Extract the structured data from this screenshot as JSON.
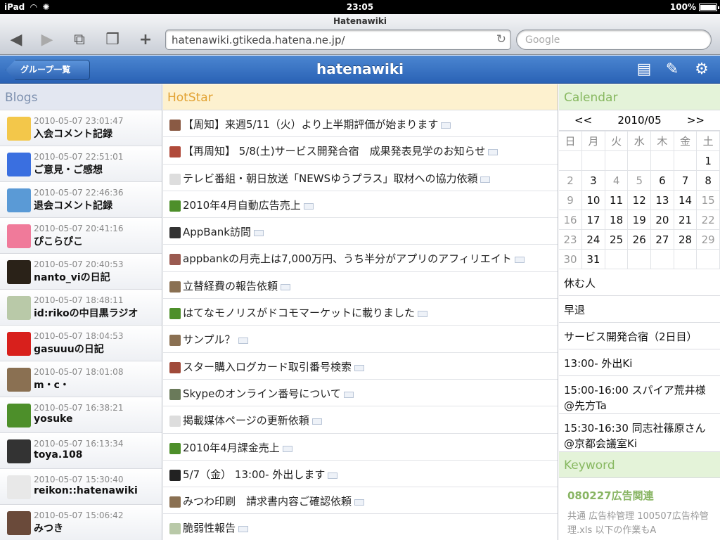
{
  "status": {
    "device": "iPad",
    "time": "23:05",
    "battery": "100%"
  },
  "browser": {
    "title": "Hatenawiki",
    "url": "hatenawiki.gtikeda.hatena.ne.jp/",
    "search_placeholder": "Google"
  },
  "nav": {
    "back_label": "グループ一覧",
    "title": "hatenawiki"
  },
  "blogs": {
    "header": "Blogs",
    "items": [
      {
        "date": "2010-05-07 23:01:47",
        "name": "入会コメント記録",
        "color": "#f3c74a"
      },
      {
        "date": "2010-05-07 22:51:01",
        "name": "ご意見・ご感想",
        "color": "#3a6fe0"
      },
      {
        "date": "2010-05-07 22:46:36",
        "name": "退会コメント記録",
        "color": "#5a9ad6"
      },
      {
        "date": "2010-05-07 20:41:16",
        "name": "ぴこらぴこ",
        "color": "#f07a9a"
      },
      {
        "date": "2010-05-07 20:40:53",
        "name": "nanto_viの日記",
        "color": "#2a2218"
      },
      {
        "date": "2010-05-07 18:48:11",
        "name": "id:rikoの中目黒ラジオ",
        "color": "#b9c9a8"
      },
      {
        "date": "2010-05-07 18:04:53",
        "name": "gasuuuの日記",
        "color": "#d8201c"
      },
      {
        "date": "2010-05-07 18:01:08",
        "name": "m・c・",
        "color": "#8a7052"
      },
      {
        "date": "2010-05-07 16:38:21",
        "name": "yosuke",
        "color": "#4d8f2a"
      },
      {
        "date": "2010-05-07 16:13:34",
        "name": "toya.108",
        "color": "#333333"
      },
      {
        "date": "2010-05-07 15:30:40",
        "name": "reikon::hatenawiki",
        "color": "#e8e8e8"
      },
      {
        "date": "2010-05-07 15:06:42",
        "name": "みつき",
        "color": "#6a4a3a"
      }
    ]
  },
  "hotstar": {
    "header": "HotStar",
    "items": [
      {
        "text": "【周知】来週5/11（火）より上半期評価が始まります",
        "color": "#8a5a44"
      },
      {
        "text": "【再周知】 5/8(土)サービス開発合宿　成果発表見学のお知らせ",
        "color": "#b04a3a"
      },
      {
        "text": "テレビ番組・朝日放送「NEWSゆうプラス」取材への協力依頼",
        "color": "#dddddd"
      },
      {
        "text": "2010年4月自動広告売上",
        "color": "#4d8f2a"
      },
      {
        "text": "AppBank訪問",
        "color": "#333333"
      },
      {
        "text": "appbankの月売上は7,000万円、うち半分がアプリのアフィリエイト",
        "color": "#9a5a50"
      },
      {
        "text": "立替経費の報告依頼",
        "color": "#8a7052"
      },
      {
        "text": "はてなモノリスがドコモマーケットに載りました",
        "color": "#4d8f2a"
      },
      {
        "text": "サンプル？",
        "color": "#8a7052"
      },
      {
        "text": "スター購入ログカード取引番号検索",
        "color": "#a04a3a"
      },
      {
        "text": "Skypeのオンライン番号について",
        "color": "#6a7a5a"
      },
      {
        "text": "掲載媒体ページの更新依頼",
        "color": "#dddddd"
      },
      {
        "text": "2010年4月課金売上",
        "color": "#4d8f2a"
      },
      {
        "text": "5/7（金） 13:00- 外出します",
        "color": "#222222"
      },
      {
        "text": "みつわ印刷　請求書内容ご確認依頼",
        "color": "#8a7052"
      },
      {
        "text": "脆弱性報告",
        "color": "#b9c9a8"
      }
    ]
  },
  "calendar": {
    "header": "Calendar",
    "prev": "<<",
    "month": "2010/05",
    "next": ">>",
    "weekdays": [
      "日",
      "月",
      "火",
      "水",
      "木",
      "金",
      "土"
    ],
    "weeks": [
      [
        {
          "d": ""
        },
        {
          "d": ""
        },
        {
          "d": ""
        },
        {
          "d": ""
        },
        {
          "d": ""
        },
        {
          "d": ""
        },
        {
          "d": "1"
        }
      ],
      [
        {
          "d": "2",
          "g": 1
        },
        {
          "d": "3"
        },
        {
          "d": "4",
          "g": 1
        },
        {
          "d": "5",
          "g": 1
        },
        {
          "d": "6"
        },
        {
          "d": "7"
        },
        {
          "d": "8"
        }
      ],
      [
        {
          "d": "9",
          "g": 1
        },
        {
          "d": "10"
        },
        {
          "d": "11"
        },
        {
          "d": "12"
        },
        {
          "d": "13"
        },
        {
          "d": "14"
        },
        {
          "d": "15",
          "g": 1
        }
      ],
      [
        {
          "d": "16",
          "g": 1
        },
        {
          "d": "17"
        },
        {
          "d": "18"
        },
        {
          "d": "19"
        },
        {
          "d": "20"
        },
        {
          "d": "21"
        },
        {
          "d": "22",
          "g": 1
        }
      ],
      [
        {
          "d": "23",
          "g": 1
        },
        {
          "d": "24"
        },
        {
          "d": "25"
        },
        {
          "d": "26"
        },
        {
          "d": "27"
        },
        {
          "d": "28"
        },
        {
          "d": "29",
          "g": 1
        }
      ],
      [
        {
          "d": "30",
          "g": 1
        },
        {
          "d": "31"
        },
        {
          "d": ""
        },
        {
          "d": ""
        },
        {
          "d": ""
        },
        {
          "d": ""
        },
        {
          "d": ""
        }
      ]
    ],
    "schedule": [
      "休む人",
      "早退",
      "サービス開発合宿（2日目）",
      "13:00- 外出Ki",
      "15:00-16:00 スパイア荒井様@先方Ta",
      "15:30-16:30 同志社篠原さん@京都会議室Ki"
    ]
  },
  "keyword": {
    "header": "Keyword",
    "title": "080227広告関連",
    "desc": "共通 広告枠管理 100507広告枠管理.xls 以下の作業もA"
  },
  "colors": {
    "nav": "#2a62b5",
    "hotstar_bg": "#fdf1cf",
    "calendar_bg": "#e4f3d9",
    "blogs_bg": "#e3e7f1"
  }
}
